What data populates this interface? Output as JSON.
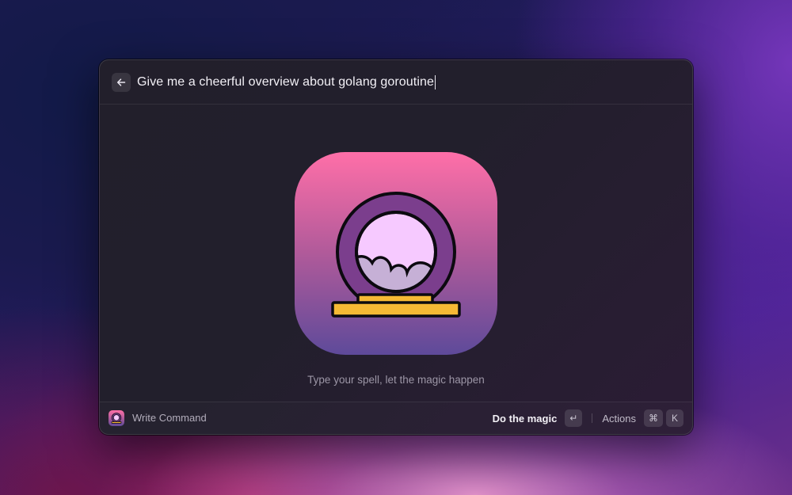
{
  "search": {
    "query": "Give me a cheerful overview about golang goroutine"
  },
  "icons": {
    "back": "arrow-left-icon",
    "app": "crystal-ball-icon",
    "enter": "return-key-icon"
  },
  "main": {
    "tagline": "Type your spell, let the magic happen"
  },
  "footer": {
    "left_label": "Write Command",
    "primary_action": "Do the magic",
    "primary_shortcut": "↵",
    "secondary_action": "Actions",
    "secondary_shortcut_1": "⌘",
    "secondary_shortcut_2": "K"
  },
  "colors": {
    "icon_gradient_top": "#ff6fa8",
    "icon_gradient_bottom": "#5e4a9a",
    "ball_frame": "#7b3e8d",
    "ball_glass": "#f6c9ff",
    "cloud": "#c6b0d6",
    "base": "#f6b935"
  }
}
